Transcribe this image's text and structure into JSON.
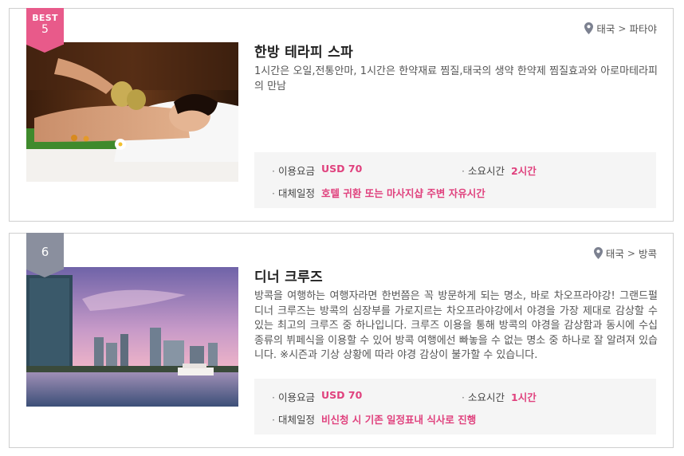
{
  "cards": [
    {
      "badge_label": "BEST",
      "badge_number": "5",
      "location": {
        "country": "태국",
        "separator": ">",
        "city": "파타야"
      },
      "title": "한방 테라피 스파",
      "description": "1시간은 오일,전통안마, 1시간은 한약재료 찜질,태국의 생약 한약제 찜질효과와 아로마테라피의 만남",
      "info": {
        "price_label": "이용요금",
        "price_value": "USD 70",
        "duration_label": "소요시간",
        "duration_value": "2시간",
        "alt_label": "대체일정",
        "alt_value": "호텔 귀환 또는 마사지샵 주변 자유시간"
      },
      "icons": [
        "location-pin-icon"
      ],
      "photo": "spa-massage-photo"
    },
    {
      "badge_label": "",
      "badge_number": "6",
      "location": {
        "country": "태국",
        "separator": ">",
        "city": "방콕"
      },
      "title": "디너 크루즈",
      "description": "방콕을 여행하는 여행자라면 한번쯤은 꼭 방문하게 되는 명소, 바로 차오프라야강! 그랜드펄 디너 크루즈는 방콕의 심장부를 가로지르는 차오프라야강에서 야경을 가장 제대로 감상할 수 있는 최고의 크루즈 중 하나입니다. 크루즈 이용을 통해 방콕의 야경을 감상함과 동시에 수십 종류의 뷔페식을 이용할 수 있어 방콕 여행에선 빠놓을 수 없는 명소 중 하나로 잘 알려져 있습니다. ※시즌과 기상 상황에 따라 야경 감상이 불가할 수 있습니다.",
      "info": {
        "price_label": "이용요금",
        "price_value": "USD 70",
        "duration_label": "소요시간",
        "duration_value": "1시간",
        "alt_label": "대체일정",
        "alt_value": "비신청 시 기존 일정표내 식사로 진행"
      },
      "icons": [
        "location-pin-icon"
      ],
      "photo": "bangkok-river-skyline-photo"
    }
  ],
  "colors": {
    "accent": "#e0427e",
    "best_badge": "#e85a8a",
    "rank_badge": "#8a8f9e",
    "info_bg": "#f5f5f5"
  }
}
